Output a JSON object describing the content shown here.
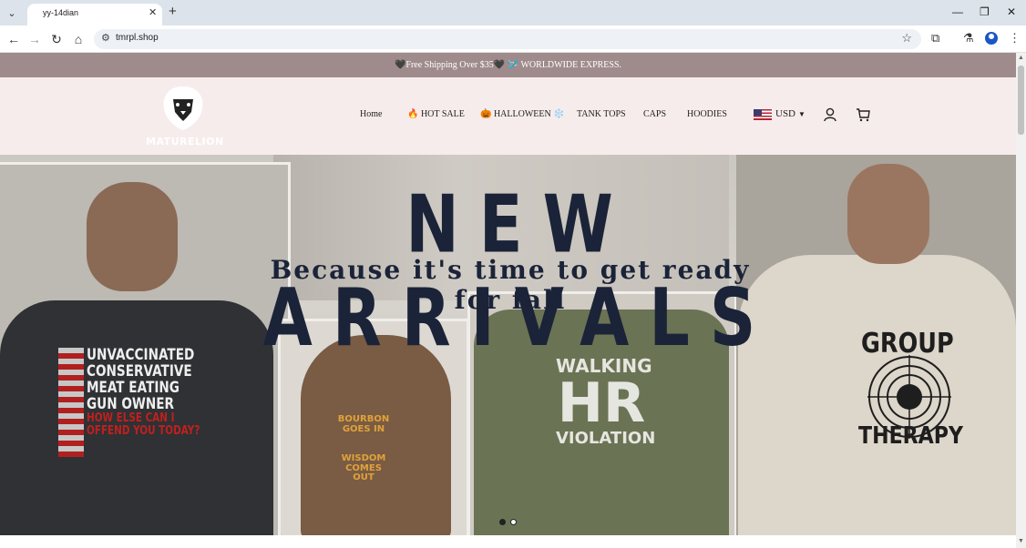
{
  "browser": {
    "tab_title": "yy-14dian",
    "url": "tmrpl.shop",
    "new_tab": "+",
    "close": "✕"
  },
  "announcement": "🖤Free Shipping Over $35🖤 🛩️ WORLDWIDE EXPRESS.",
  "logo": {
    "text": "MATURELION"
  },
  "nav": [
    {
      "label": "Home"
    },
    {
      "label": "🔥 HOT SALE"
    },
    {
      "label": "🎃 HALLOWEEN ❄️"
    },
    {
      "label": "TANK TOPS"
    },
    {
      "label": "CAPS"
    },
    {
      "label": "HOODIES"
    }
  ],
  "currency": {
    "selected": "USD"
  },
  "hero": {
    "headline": "NEW ARRIVALS",
    "tagline": "Because it's time to get ready for fall",
    "shirt_prints": [
      {
        "lines": [
          "UNVACCINATED",
          "CONSERVATIVE",
          "MEAT EATING",
          "GUN OWNER"
        ],
        "sub": [
          "HOW ELSE CAN I",
          "OFFEND YOU TODAY?"
        ]
      },
      {
        "lines": [
          "BOURBON",
          "GOES IN",
          "WISDOM",
          "COMES OUT"
        ]
      },
      {
        "lines": [
          "WALKING",
          "HR",
          "VIOLATION"
        ]
      },
      {
        "lines": [
          "GROUP",
          "THERAPY"
        ]
      }
    ],
    "slides": 2,
    "active_slide": 1
  },
  "colors": {
    "announce_bg": "#a08b8c",
    "header_bg": "#f7ecec",
    "headline": "#1b2338"
  }
}
